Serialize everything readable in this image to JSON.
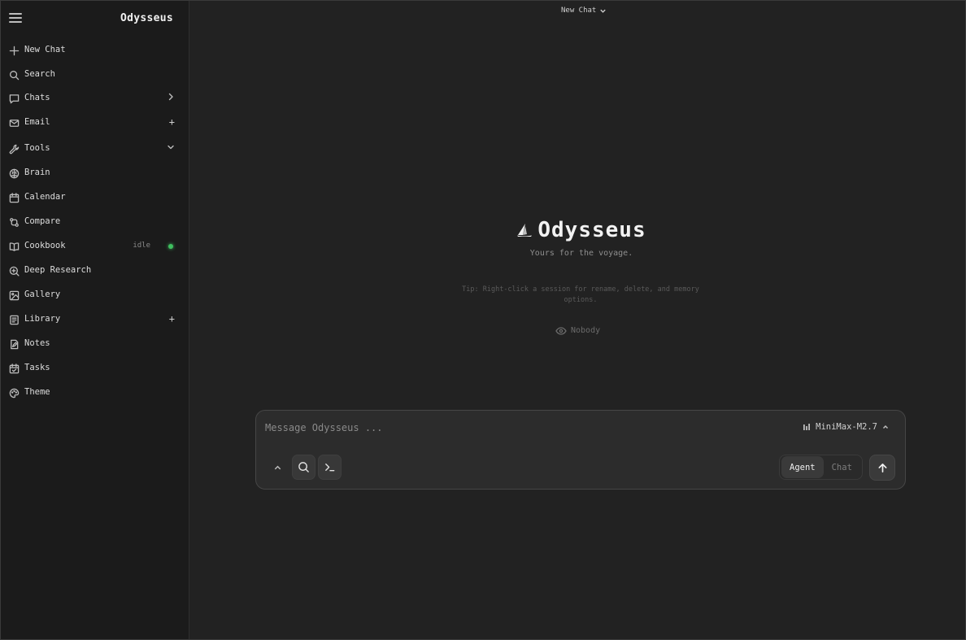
{
  "app": {
    "brand": "Odysseus"
  },
  "sidebar": {
    "items": [
      {
        "label": "New Chat",
        "icon": "plus-icon"
      },
      {
        "label": "Search",
        "icon": "search-icon"
      },
      {
        "label": "Chats",
        "icon": "chat-bubble-icon",
        "right": "chevron-right"
      },
      {
        "label": "Email",
        "icon": "mail-icon",
        "right": "+"
      },
      {
        "label": "Tools",
        "icon": "wrench-icon",
        "right": "chevron-down"
      },
      {
        "label": "Brain",
        "icon": "brain-icon"
      },
      {
        "label": "Calendar",
        "icon": "calendar-icon"
      },
      {
        "label": "Compare",
        "icon": "compare-icon"
      },
      {
        "label": "Cookbook",
        "icon": "book-icon",
        "status": "idle",
        "status_color": "#3fbf5f"
      },
      {
        "label": "Deep Research",
        "icon": "research-icon"
      },
      {
        "label": "Gallery",
        "icon": "image-icon"
      },
      {
        "label": "Library",
        "icon": "library-icon",
        "right": "+"
      },
      {
        "label": "Notes",
        "icon": "notes-icon"
      },
      {
        "label": "Tasks",
        "icon": "tasks-icon"
      },
      {
        "label": "Theme",
        "icon": "palette-icon"
      }
    ]
  },
  "header": {
    "title": "New Chat"
  },
  "hero": {
    "title": "Odysseus",
    "tagline": "Yours for the voyage.",
    "tip": "Tip: Right-click a session for rename, delete, and memory options.",
    "visibility": "Nobody"
  },
  "composer": {
    "placeholder": "Message Odysseus ...",
    "model": "MiniMax-M2.7",
    "modes": [
      "Agent",
      "Chat"
    ],
    "active_mode": "Agent"
  }
}
